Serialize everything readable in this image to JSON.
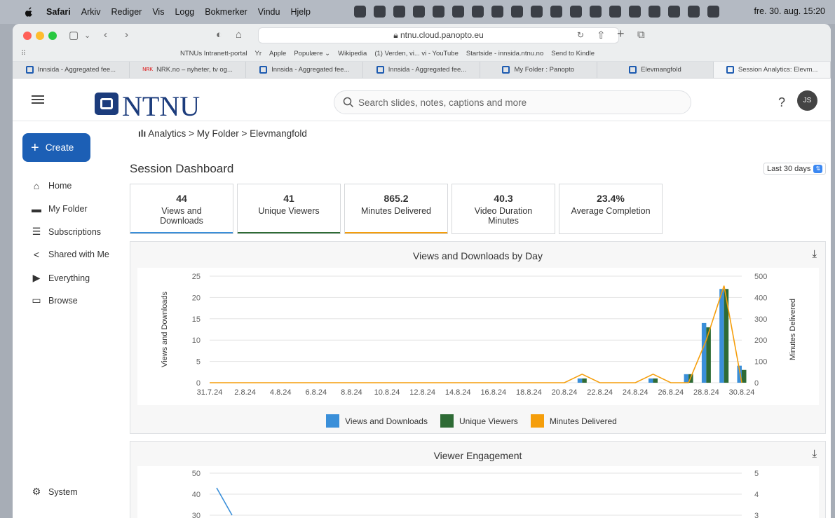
{
  "menubar": {
    "app": "Safari",
    "items": [
      "Arkiv",
      "Rediger",
      "Vis",
      "Logg",
      "Bokmerker",
      "Vindu",
      "Hjelp"
    ],
    "clock": "fre. 30. aug. 15:20"
  },
  "browser": {
    "url": "ntnu.cloud.panopto.eu",
    "favorites": [
      "NTNUs Intranett-portal",
      "Yr",
      "Apple",
      "Populære ⌄",
      "Wikipedia",
      "(1) Verden, vi... vi - YouTube",
      "Startside - innsida.ntnu.no",
      "Send to Kindle"
    ],
    "tabs": [
      "Innsida - Aggregated fee...",
      "NRK.no – nyheter, tv og...",
      "Innsida - Aggregated fee...",
      "Innsida - Aggregated fee...",
      "My Folder : Panopto",
      "Elevmangfold",
      "Session Analytics: Elevm..."
    ],
    "active_tab": 6
  },
  "header": {
    "logo_text": "NTNU",
    "search_placeholder": "Search slides, notes, captions and more",
    "help": "?",
    "avatar": "JS"
  },
  "sidebar": {
    "create": "Create",
    "items": [
      "Home",
      "My Folder",
      "Subscriptions",
      "Shared with Me",
      "Everything",
      "Browse"
    ],
    "system": "System"
  },
  "main": {
    "breadcrumb": [
      "Analytics",
      "My Folder",
      "Elevmangfold"
    ],
    "title": "Session Dashboard",
    "range": "Last 30 days",
    "stats": [
      {
        "value": "44",
        "label": "Views and Downloads",
        "color": "#3a8fd9"
      },
      {
        "value": "41",
        "label": "Unique Viewers",
        "color": "#2e6b35"
      },
      {
        "value": "865.2",
        "label": "Minutes Delivered",
        "color": "#f59e0b"
      },
      {
        "value": "40.3",
        "label": "Video Duration Minutes",
        "color": ""
      },
      {
        "value": "23.4%",
        "label": "Average Completion",
        "color": ""
      }
    ],
    "chart1_title": "Views and Downloads by Day",
    "chart2_title": "Viewer Engagement"
  },
  "chart_data": [
    {
      "type": "bar",
      "title": "Views and Downloads by Day",
      "ylabel": "Views and Downloads",
      "y2label": "Minutes Delivered",
      "ylim": [
        0,
        25
      ],
      "y2lim": [
        0,
        500
      ],
      "yticks": [
        0,
        5,
        10,
        15,
        20,
        25
      ],
      "y2ticks": [
        0,
        100,
        200,
        300,
        400,
        500
      ],
      "xtick_labels": [
        "31.7.24",
        "2.8.24",
        "4.8.24",
        "6.8.24",
        "8.8.24",
        "10.8.24",
        "12.8.24",
        "14.8.24",
        "16.8.24",
        "18.8.24",
        "20.8.24",
        "22.8.24",
        "24.8.24",
        "26.8.24",
        "28.8.24",
        "30.8.24"
      ],
      "categories": [
        "31.7.24",
        "1.8.24",
        "2.8.24",
        "3.8.24",
        "4.8.24",
        "5.8.24",
        "6.8.24",
        "7.8.24",
        "8.8.24",
        "9.8.24",
        "10.8.24",
        "11.8.24",
        "12.8.24",
        "13.8.24",
        "14.8.24",
        "15.8.24",
        "16.8.24",
        "17.8.24",
        "18.8.24",
        "19.8.24",
        "20.8.24",
        "21.8.24",
        "22.8.24",
        "23.8.24",
        "24.8.24",
        "25.8.24",
        "26.8.24",
        "27.8.24",
        "28.8.24",
        "29.8.24",
        "30.8.24"
      ],
      "series": [
        {
          "name": "Views and Downloads",
          "color": "#3a8fd9",
          "values": [
            0,
            0,
            0,
            0,
            0,
            0,
            0,
            0,
            0,
            0,
            0,
            0,
            0,
            0,
            0,
            0,
            0,
            0,
            0,
            0,
            0,
            1,
            0,
            0,
            0,
            1,
            0,
            2,
            14,
            22,
            4
          ]
        },
        {
          "name": "Unique Viewers",
          "color": "#2e6b35",
          "values": [
            0,
            0,
            0,
            0,
            0,
            0,
            0,
            0,
            0,
            0,
            0,
            0,
            0,
            0,
            0,
            0,
            0,
            0,
            0,
            0,
            0,
            1,
            0,
            0,
            0,
            1,
            0,
            2,
            13,
            22,
            3
          ]
        },
        {
          "name": "Minutes Delivered",
          "color": "#f59e0b",
          "axis": "right",
          "values": [
            0,
            0,
            0,
            0,
            0,
            0,
            0,
            0,
            0,
            0,
            0,
            0,
            0,
            0,
            0,
            0,
            0,
            0,
            0,
            0,
            0,
            40,
            0,
            0,
            0,
            40,
            0,
            0,
            200,
            455,
            0
          ]
        }
      ],
      "legend": "bottom"
    },
    {
      "type": "line",
      "title": "Viewer Engagement",
      "ylim_visible": [
        30,
        50
      ],
      "yticks": [
        30,
        40,
        50
      ],
      "y2ticks": [
        3,
        4,
        5
      ],
      "series": [
        {
          "color": "#3a8fd9",
          "values": [
            43,
            30
          ]
        }
      ]
    }
  ]
}
